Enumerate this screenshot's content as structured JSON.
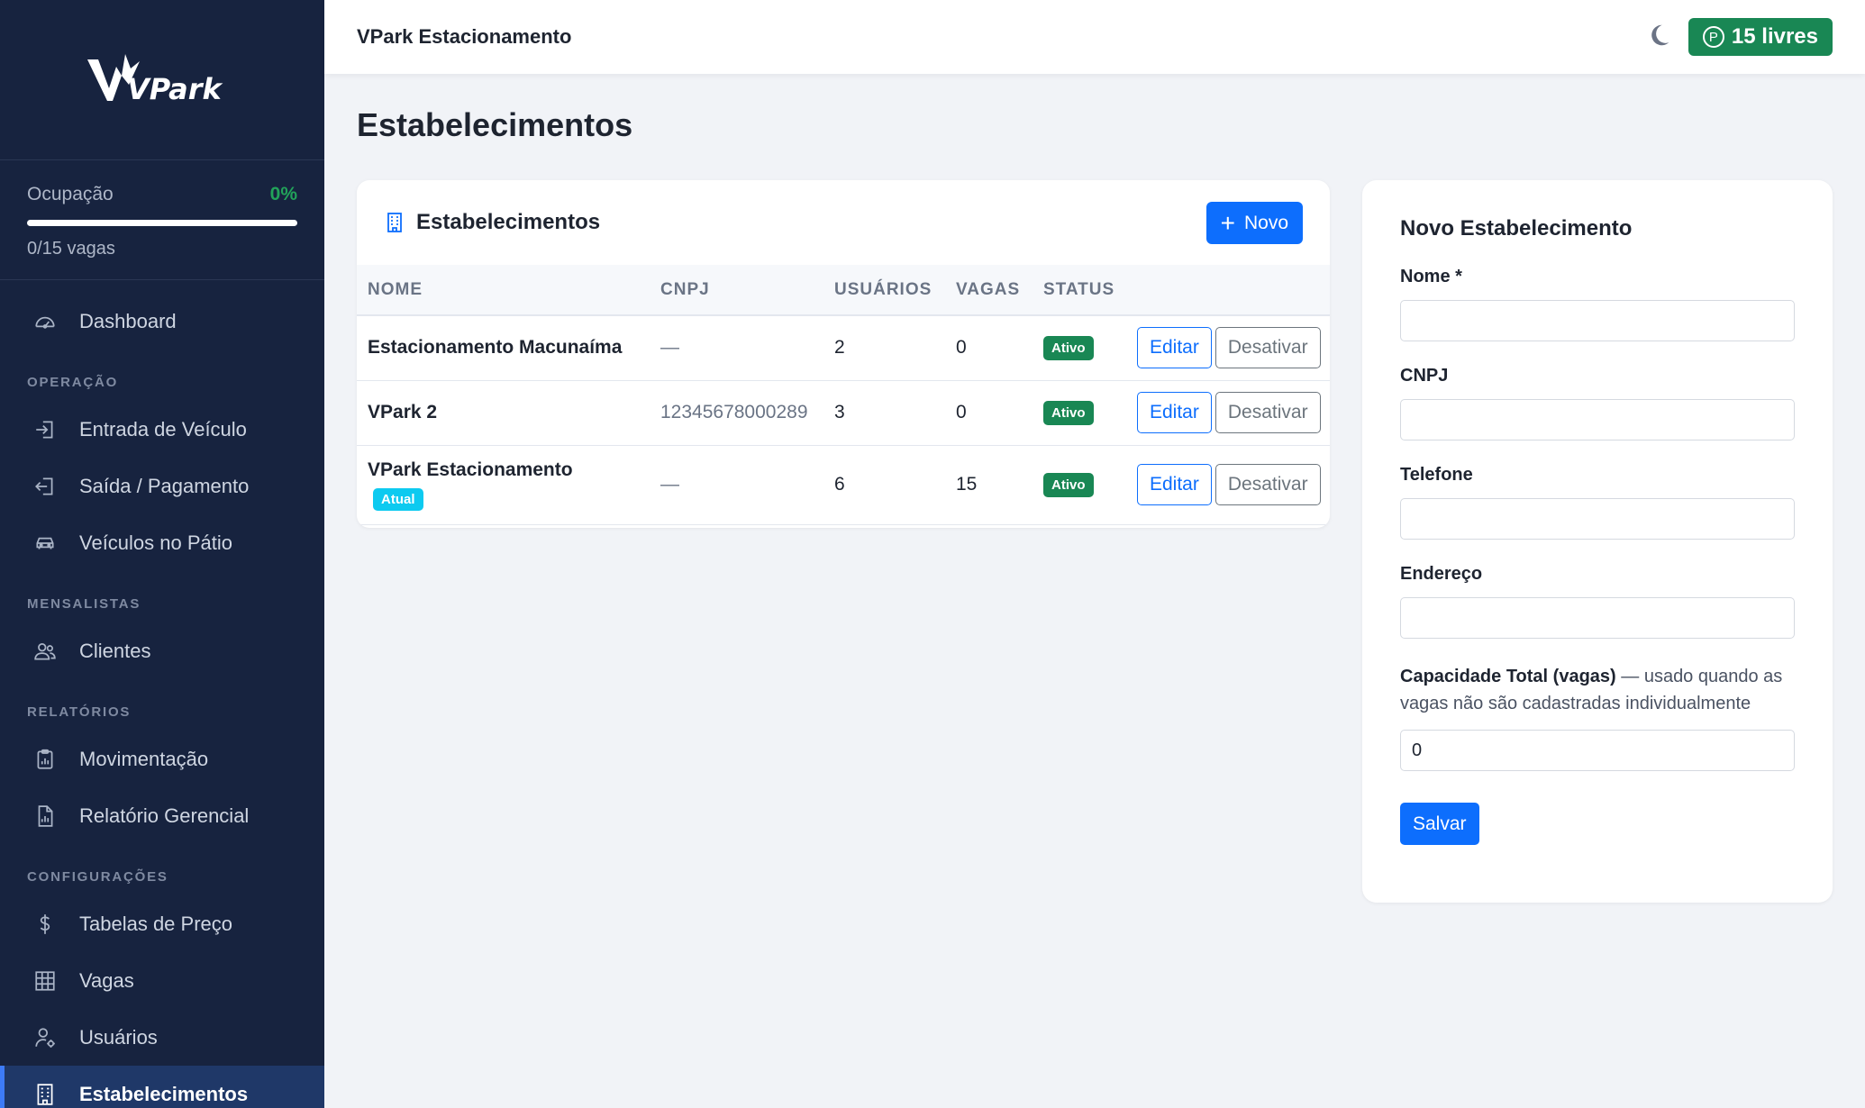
{
  "app": {
    "logo_text": "VPark",
    "topbar_title": "VPark Estacionamento",
    "livres_label": "15 livres"
  },
  "colors": {
    "sidebar_bg": "#17233f",
    "primary": "#0d6efd",
    "success": "#198754",
    "info": "#0dcaf0"
  },
  "occupancy": {
    "label": "Ocupação",
    "percent_text": "0%",
    "percent": 0,
    "vagas_text": "0/15 vagas"
  },
  "nav": {
    "dashboard": "Dashboard",
    "section_operacao": "OPERAÇÃO",
    "entrada": "Entrada de Veículo",
    "saida": "Saída / Pagamento",
    "patio": "Veículos no Pátio",
    "section_mensalistas": "MENSALISTAS",
    "clientes": "Clientes",
    "section_relatorios": "RELATÓRIOS",
    "movimentacao": "Movimentação",
    "gerencial": "Relatório Gerencial",
    "section_config": "CONFIGURAÇÕES",
    "precos": "Tabelas de Preço",
    "vagas": "Vagas",
    "usuarios": "Usuários",
    "estabelecimentos": "Estabelecimentos"
  },
  "page": {
    "title": "Estabelecimentos"
  },
  "list": {
    "title": "Estabelecimentos",
    "new_button": "Novo",
    "columns": [
      "NOME",
      "CNPJ",
      "USUÁRIOS",
      "VAGAS",
      "STATUS"
    ],
    "rows": [
      {
        "name": "Estacionamento Macunaíma",
        "cnpj": "—",
        "usuarios": "2",
        "vagas": "0",
        "status": "Ativo",
        "edit": "Editar",
        "deactivate": "Desativar"
      },
      {
        "name": "VPark 2",
        "cnpj": "12345678000289",
        "usuarios": "3",
        "vagas": "0",
        "status": "Ativo",
        "edit": "Editar",
        "deactivate": "Desativar"
      },
      {
        "name": "VPark Estacionamento",
        "tag": "Atual",
        "cnpj": "—",
        "usuarios": "6",
        "vagas": "15",
        "status": "Ativo",
        "edit": "Editar",
        "deactivate": "Desativar"
      }
    ]
  },
  "form": {
    "title": "Novo Estabelecimento",
    "nome_label": "Nome *",
    "nome_value": "",
    "cnpj_label": "CNPJ",
    "cnpj_value": "",
    "telefone_label": "Telefone",
    "telefone_value": "",
    "endereco_label": "Endereço",
    "endereco_value": "",
    "capacidade_label": "Capacidade Total (vagas)",
    "capacidade_hint": " — usado quando as vagas não são cadastradas individualmente",
    "capacidade_value": "0",
    "save_button": "Salvar"
  }
}
